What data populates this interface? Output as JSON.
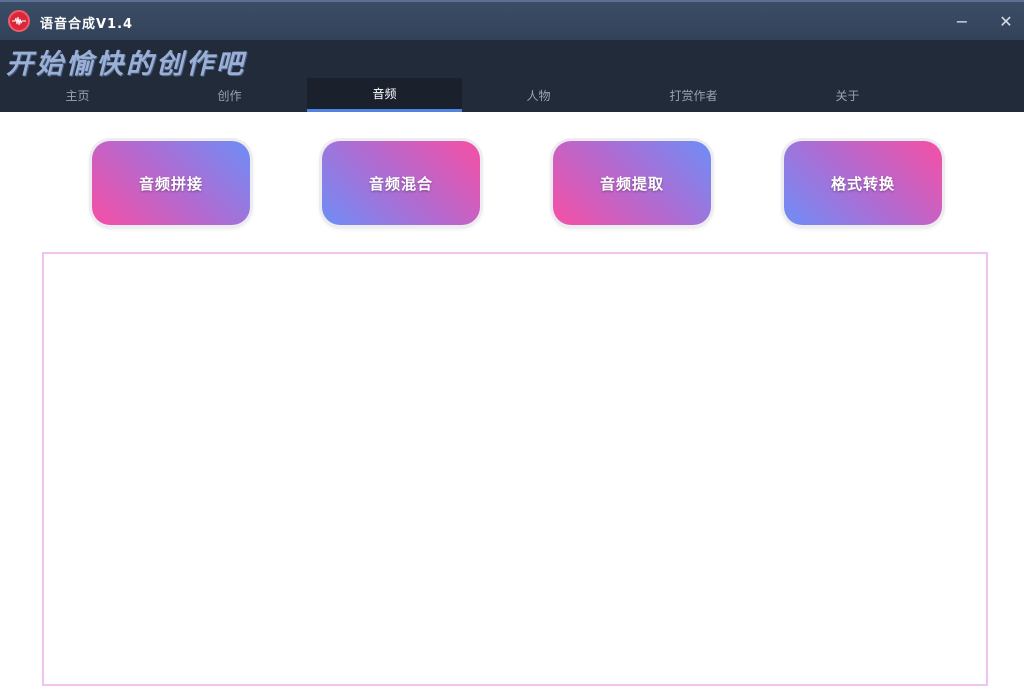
{
  "window": {
    "title": "语音合成V1.4",
    "minimize_glyph": "−",
    "close_glyph": "✕"
  },
  "header": {
    "slogan": "开始愉快的创作吧"
  },
  "tabs": [
    {
      "label": "主页",
      "active": false
    },
    {
      "label": "创作",
      "active": false
    },
    {
      "label": "音频",
      "active": true
    },
    {
      "label": "人物",
      "active": false
    },
    {
      "label": "打赏作者",
      "active": false
    },
    {
      "label": "关于",
      "active": false
    }
  ],
  "actions": [
    {
      "label": "音频拼接"
    },
    {
      "label": "音频混合"
    },
    {
      "label": "音频提取"
    },
    {
      "label": "格式转换"
    }
  ],
  "colors": {
    "titlebar": "#324259",
    "header": "#222b39",
    "active_tab_underline": "#4f85e0",
    "button_pink": "#f64fa4",
    "button_blue": "#6d8ef6",
    "content_border": "#f0c4f0"
  },
  "icons": {
    "app": "audio-wave-icon",
    "minimize": "minimize-icon",
    "close": "close-icon"
  }
}
